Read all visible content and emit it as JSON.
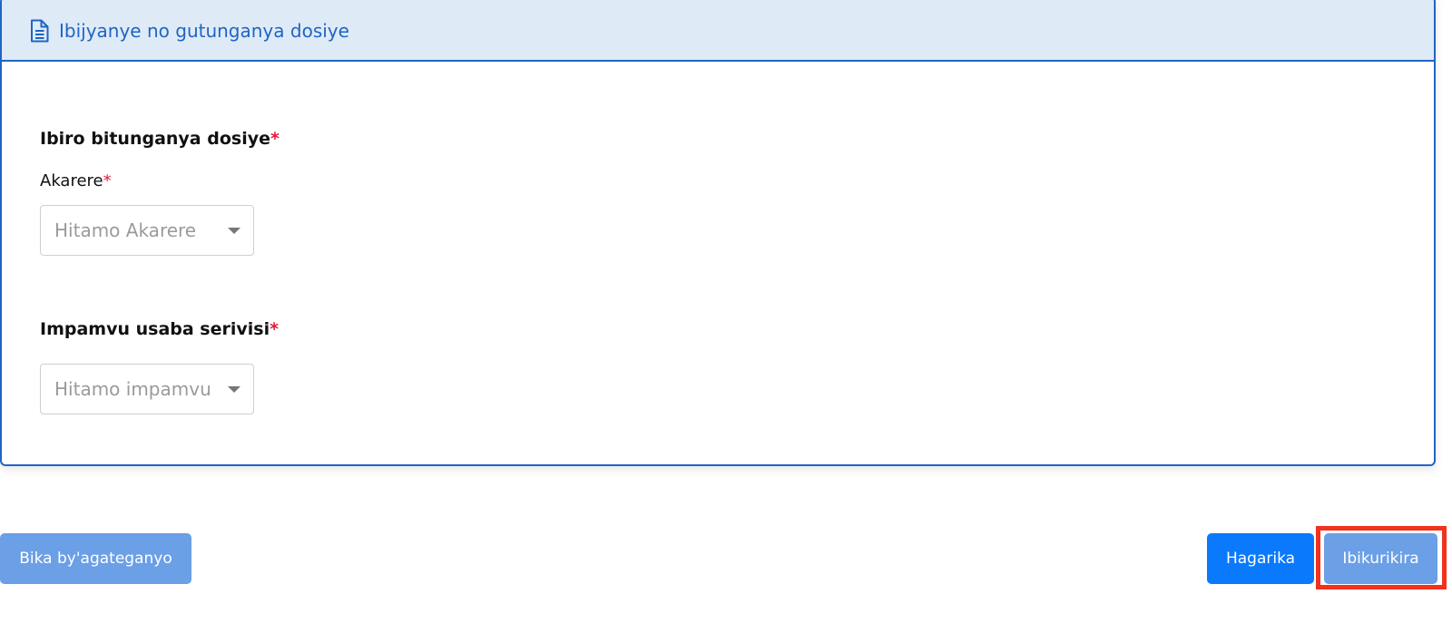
{
  "card": {
    "header_title": "Ibijyanye no gutunganya dosiye",
    "header_icon": "document-icon",
    "accent_color": "#1f65c4"
  },
  "office_section": {
    "title": "Ibiro bitunganya dosiye",
    "required_mark": "*",
    "district_label": "Akarere",
    "district_required_mark": "*",
    "district_placeholder": "Hitamo Akarere"
  },
  "reason_section": {
    "title": "Impamvu usaba serivisi",
    "required_mark": "*",
    "reason_placeholder": "Hitamo impamvu usaba serivisi"
  },
  "footer": {
    "previous_label": "Bika by'agateganyo",
    "cancel_label": "Hagarika",
    "next_label": "Ibikurikira"
  },
  "colors": {
    "primary_button": "#0a79fb",
    "muted_button": "#6b9fe6",
    "required": "#e8173a",
    "highlight": "#f2311e"
  }
}
